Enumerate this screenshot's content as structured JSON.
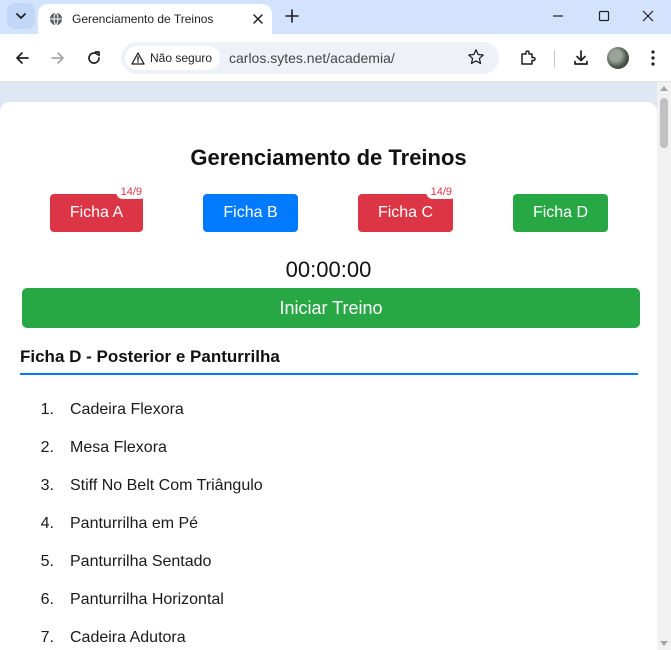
{
  "browser": {
    "tab_title": "Gerenciamento de Treinos",
    "security_label": "Não seguro",
    "url": "carlos.sytes.net/academia/"
  },
  "page": {
    "title": "Gerenciamento de Treinos",
    "fichas": [
      {
        "label": "Ficha A",
        "badge": "14/9",
        "color": "#dc3545"
      },
      {
        "label": "Ficha B",
        "badge": "",
        "color": "#007bff"
      },
      {
        "label": "Ficha C",
        "badge": "14/9",
        "color": "#dc3545"
      },
      {
        "label": "Ficha D",
        "badge": "",
        "color": "#28a745"
      }
    ],
    "timer": "00:00:00",
    "start_button": "Iniciar Treino",
    "section_title": "Ficha D - Posterior e Panturrilha",
    "exercises": [
      {
        "num": "1.",
        "name": "Cadeira Flexora"
      },
      {
        "num": "2.",
        "name": "Mesa Flexora"
      },
      {
        "num": "3.",
        "name": "Stiff No Belt Com Triângulo"
      },
      {
        "num": "4.",
        "name": "Panturrilha em Pé"
      },
      {
        "num": "5.",
        "name": "Panturrilha Sentado"
      },
      {
        "num": "6.",
        "name": "Panturrilha Horizontal"
      },
      {
        "num": "7.",
        "name": "Cadeira Adutora"
      }
    ]
  },
  "icons": {
    "tab_search": "chevron-down-icon",
    "favicon": "globe-icon",
    "tab_close": "close-icon",
    "new_tab": "plus-icon",
    "back": "arrow-left-icon",
    "forward": "arrow-right-icon",
    "reload": "reload-icon",
    "warning": "warning-icon",
    "bookmark": "star-icon",
    "extensions": "puzzle-icon",
    "download": "download-icon",
    "menu": "kebab-menu-icon"
  },
  "colors": {
    "red": "#dc3545",
    "blue": "#007bff",
    "green": "#28a745"
  }
}
